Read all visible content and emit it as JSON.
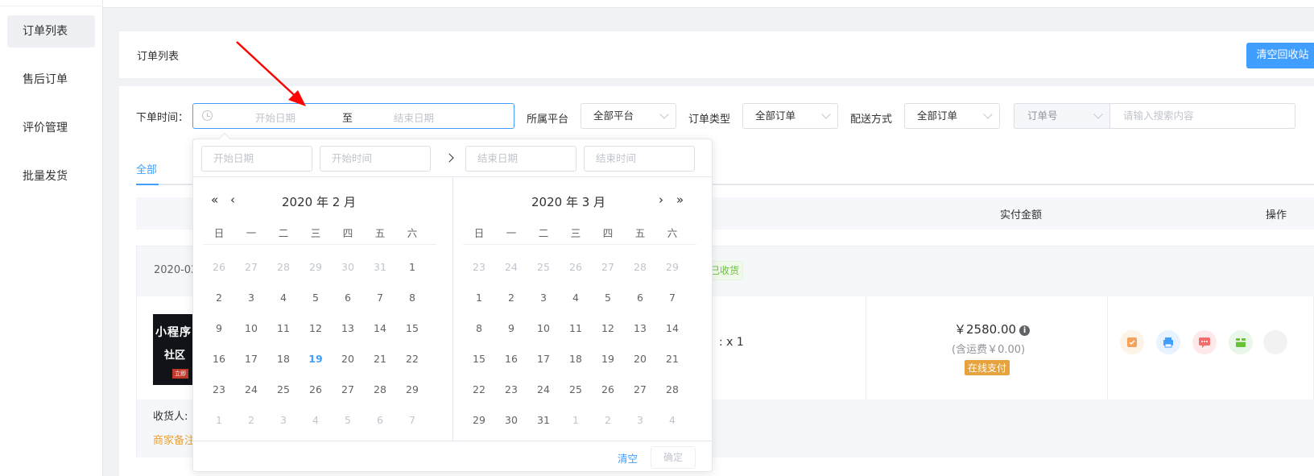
{
  "sidebar": {
    "items": [
      {
        "label": "订单列表"
      },
      {
        "label": "售后订单"
      },
      {
        "label": "评价管理"
      },
      {
        "label": "批量发货"
      }
    ]
  },
  "header": {
    "title": "订单列表",
    "recycle_button": "清空回收站"
  },
  "filters": {
    "order_time_label": "下单时间：",
    "start_placeholder": "开始日期",
    "range_separator": "至",
    "end_placeholder": "结束日期",
    "platform_label": "所属平台",
    "platform_value": "全部平台",
    "order_type_label": "订单类型",
    "order_type_value": "全部订单",
    "delivery_label": "配送方式",
    "delivery_value": "全部订单",
    "search_field": "订单号",
    "search_placeholder": "请输入搜索内容"
  },
  "tabs": {
    "all": "全部"
  },
  "table": {
    "col_paid": "实付金额",
    "col_ops": "操作"
  },
  "order": {
    "date_fragment": "2020-02",
    "status": "已收货",
    "thumb_line1": "小程序",
    "thumb_line2": "社区",
    "thumb_line3": "立即",
    "quantity": "x 1",
    "quantity_prefix": ":",
    "price": "￥2580.00",
    "shipping": "(含运费￥0.00)",
    "pay_method": "在线支付",
    "receiver_label": "收货人:",
    "remark_label": "商家备注"
  },
  "picker": {
    "start_date_ph": "开始日期",
    "start_time_ph": "开始时间",
    "end_date_ph": "结束日期",
    "end_time_ph": "结束时间",
    "left_title": "2020 年 2 月",
    "right_title": "2020 年 3 月",
    "weekdays": [
      "日",
      "一",
      "二",
      "三",
      "四",
      "五",
      "六"
    ],
    "today": 19,
    "left_weeks": [
      [
        "26",
        "27",
        "28",
        "29",
        "30",
        "31",
        "1"
      ],
      [
        "2",
        "3",
        "4",
        "5",
        "6",
        "7",
        "8"
      ],
      [
        "9",
        "10",
        "11",
        "12",
        "13",
        "14",
        "15"
      ],
      [
        "16",
        "17",
        "18",
        "19",
        "20",
        "21",
        "22"
      ],
      [
        "23",
        "24",
        "25",
        "26",
        "27",
        "28",
        "29"
      ],
      [
        "1",
        "2",
        "3",
        "4",
        "5",
        "6",
        "7"
      ]
    ],
    "right_weeks": [
      [
        "23",
        "24",
        "25",
        "26",
        "27",
        "28",
        "29"
      ],
      [
        "1",
        "2",
        "3",
        "4",
        "5",
        "6",
        "7"
      ],
      [
        "8",
        "9",
        "10",
        "11",
        "12",
        "13",
        "14"
      ],
      [
        "15",
        "16",
        "17",
        "18",
        "19",
        "20",
        "21"
      ],
      [
        "22",
        "23",
        "24",
        "25",
        "26",
        "27",
        "28"
      ],
      [
        "29",
        "30",
        "31",
        "1",
        "2",
        "3",
        "4"
      ]
    ],
    "clear": "清空",
    "confirm": "确定"
  },
  "colors": {
    "primary": "#409eff",
    "warning": "#e6a23c",
    "success": "#67c23a",
    "annotation": "#ff0000"
  }
}
